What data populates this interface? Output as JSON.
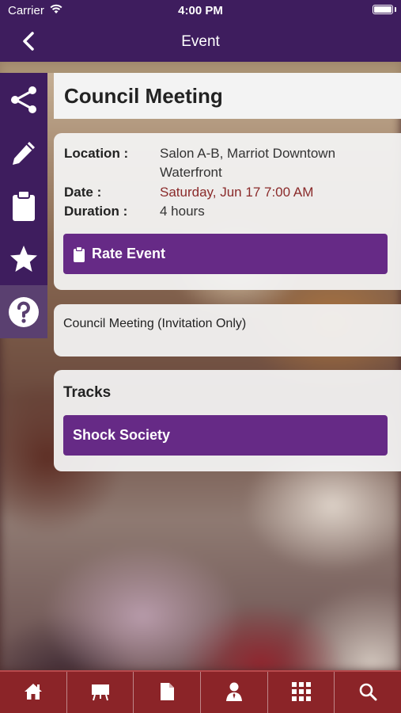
{
  "status": {
    "carrier": "Carrier",
    "time": "4:00 PM"
  },
  "nav": {
    "title": "Event"
  },
  "sidebar": [
    "share-icon",
    "pencil-icon",
    "clipboard-icon",
    "star-icon",
    "question-icon"
  ],
  "event": {
    "name": "Council Meeting",
    "location_label": "Location :",
    "location_line1": "Salon A-B, Marriot Downtown",
    "location_line2": "Waterfront",
    "date_label": "Date :",
    "date_value": "Saturday, Jun 17 7:00 AM",
    "duration_label": "Duration :",
    "duration_value": "4 hours",
    "rate_label": "Rate Event",
    "description": "Council Meeting (Invitation Only)"
  },
  "tracks": {
    "heading": "Tracks",
    "items": [
      "Shock Society"
    ]
  },
  "tabbar": [
    "home-icon",
    "presentation-icon",
    "document-icon",
    "person-icon",
    "grid-icon",
    "search-icon"
  ],
  "colors": {
    "primary": "#3e1d5e",
    "button": "#662a86",
    "tabbar": "#8b2428",
    "date": "#8a2a2a"
  }
}
